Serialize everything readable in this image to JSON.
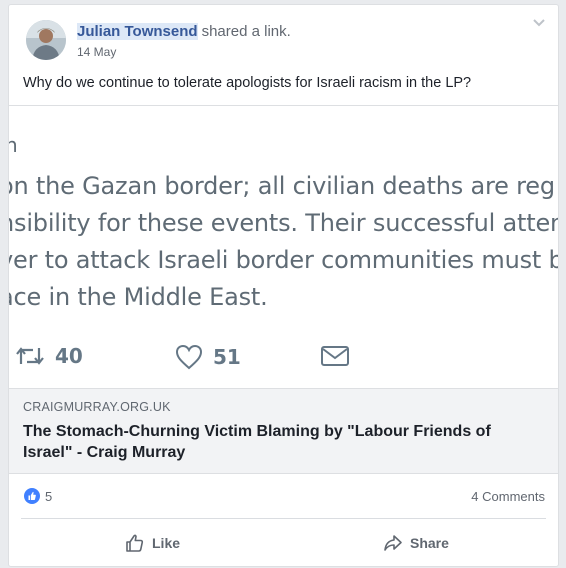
{
  "post": {
    "author": "Julian Townsend",
    "action": "shared a link.",
    "date": "14 May",
    "message": "Why do we continue to tolerate apologists for Israeli racism in the LP?"
  },
  "tweet": {
    "lines": [
      "h",
      "on the Gazan border; all civilian deaths are reg",
      "nsibility for these events. Their successful atten",
      "ver to attack Israeli border communities must b",
      "ace in the Middle East."
    ],
    "retweets": "40",
    "likes": "51"
  },
  "link": {
    "domain": "CRAIGMURRAY.ORG.UK",
    "title": "The Stomach-Churning Victim Blaming by \"Labour Friends of Israel\" - Craig Murray"
  },
  "stats": {
    "reactions": "5",
    "comments": "4 Comments"
  },
  "buttons": {
    "like": "Like",
    "share": "Share"
  },
  "colors": {
    "link_blue": "#365899",
    "fb_blue": "#4080ff",
    "tweet_gray": "#657786"
  }
}
